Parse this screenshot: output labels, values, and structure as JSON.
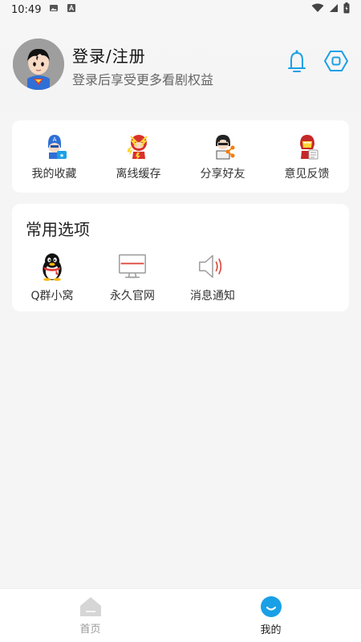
{
  "status_bar": {
    "time": "10:49"
  },
  "header": {
    "title": "登录/注册",
    "subtitle": "登录后享受更多看剧权益",
    "bell_icon": "bell-icon",
    "settings_icon": "hexagon-settings-icon"
  },
  "shortcuts": [
    {
      "label": "我的收藏",
      "icon": "captain-america-icon"
    },
    {
      "label": "离线缓存",
      "icon": "flash-icon"
    },
    {
      "label": "分享好友",
      "icon": "share-hero-icon"
    },
    {
      "label": "意见反馈",
      "icon": "iron-man-icon"
    }
  ],
  "common": {
    "title": "常用选项",
    "items": [
      {
        "label": "Q群小窝",
        "icon": "qq-penguin-icon"
      },
      {
        "label": "永久官网",
        "icon": "monitor-icon"
      },
      {
        "label": "消息通知",
        "icon": "speaker-icon"
      }
    ]
  },
  "bottom_nav": {
    "home_label": "首页",
    "mine_label": "我的"
  },
  "colors": {
    "accent": "#1aa0e6",
    "brand_red": "#d9453a",
    "inactive": "#999999"
  }
}
